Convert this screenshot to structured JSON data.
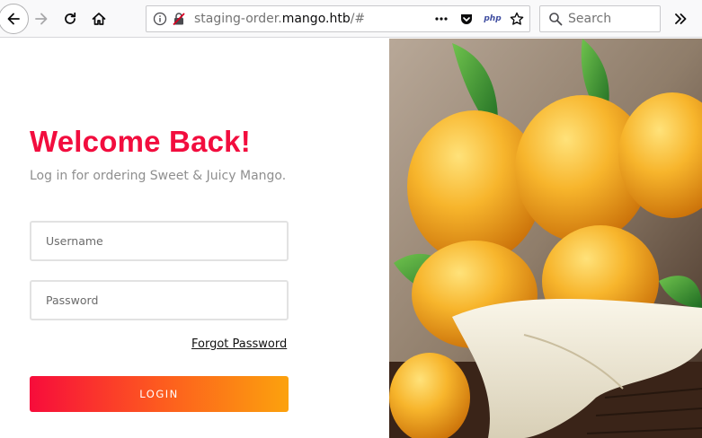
{
  "browser": {
    "url_prefix": "staging-order.",
    "url_host": "mango.htb",
    "url_suffix": "/#",
    "search_placeholder": "Search",
    "php_badge": "php"
  },
  "login": {
    "title": "Welcome Back!",
    "subtitle": "Log in for ordering Sweet & Juicy Mango.",
    "username_placeholder": "Username",
    "password_placeholder": "Password",
    "forgot_label": "Forgot Password",
    "login_label": "LOGIN"
  },
  "colors": {
    "title": "#f20d3e",
    "button_gradient_start": "#f70c3b",
    "button_gradient_end": "#fca20d"
  }
}
